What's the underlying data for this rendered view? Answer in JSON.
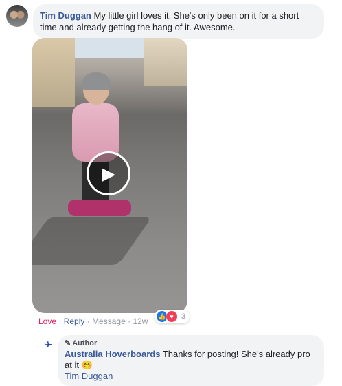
{
  "comment": {
    "author": "Tim Duggan",
    "text": "My little girl loves it. She's only been on it for a short time and already getting the hang of it. Awesome."
  },
  "actions": {
    "love": "Love",
    "reply": "Reply",
    "message": "Message",
    "time": "12w",
    "separator": " · "
  },
  "reactions": {
    "count": "3",
    "icons": [
      "like-icon",
      "love-icon"
    ]
  },
  "reply": {
    "badge": "Author",
    "author": "Australia Hoverboards",
    "text": "Thanks for posting! She's already pro at it 😊",
    "mention": "Tim Duggan"
  },
  "colors": {
    "link": "#385898",
    "love": "#e0245e",
    "bubble": "#f2f3f5",
    "meta": "#90949c"
  }
}
